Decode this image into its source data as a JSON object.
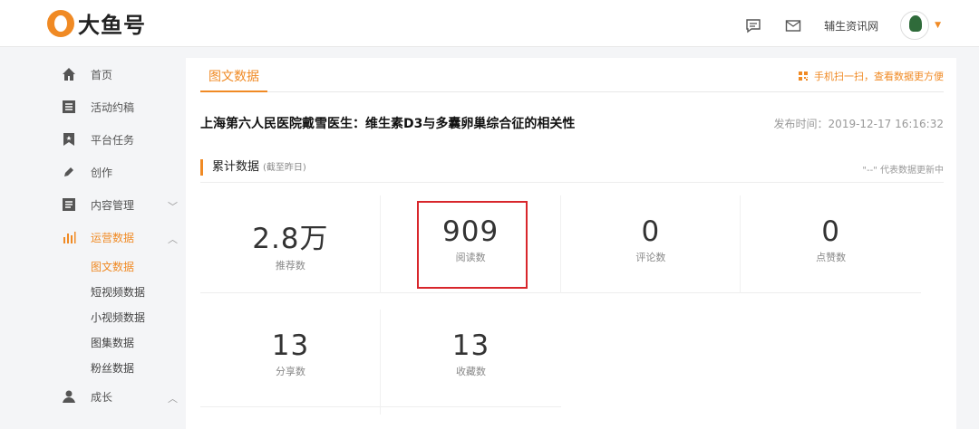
{
  "header": {
    "logo_text": "大鱼号",
    "username": "辅生资讯网",
    "icons": [
      "message-icon",
      "mail-icon",
      "avatar",
      "caret-down-icon"
    ]
  },
  "sidebar": {
    "items": [
      {
        "label": "首页",
        "icon": "home-icon"
      },
      {
        "label": "活动约稿",
        "icon": "list-icon"
      },
      {
        "label": "平台任务",
        "icon": "star-flag-icon"
      },
      {
        "label": "创作",
        "icon": "pen-icon"
      },
      {
        "label": "内容管理",
        "icon": "document-icon",
        "chevron": "down"
      },
      {
        "label": "运营数据",
        "icon": "bar-chart-icon",
        "chevron": "up",
        "active": true
      },
      {
        "label": "成长",
        "icon": "user-icon",
        "chevron": "up"
      }
    ],
    "subitems": [
      {
        "label": "图文数据",
        "active": true
      },
      {
        "label": "短视频数据"
      },
      {
        "label": "小视频数据"
      },
      {
        "label": "图集数据"
      },
      {
        "label": "粉丝数据"
      }
    ]
  },
  "content": {
    "tab": "图文数据",
    "scan_tip": "手机扫一扫，查看数据更方便",
    "article_title": "上海第六人民医院戴雪医生：维生素D3与多囊卵巢综合征的相关性",
    "publish_time": "发布时间：2019-12-17 16:16:32",
    "section_title": "累计数据",
    "section_subtitle": "(截至昨日)",
    "section_note": "\"--\" 代表数据更新中",
    "stats": [
      {
        "value": "2.8万",
        "label": "推荐数"
      },
      {
        "value": "909",
        "label": "阅读数"
      },
      {
        "value": "0",
        "label": "评论数"
      },
      {
        "value": "0",
        "label": "点赞数"
      },
      {
        "value": "13",
        "label": "分享数"
      },
      {
        "value": "13",
        "label": "收藏数"
      }
    ]
  },
  "colors": {
    "accent": "#f08a24",
    "highlight": "#d8262b"
  }
}
